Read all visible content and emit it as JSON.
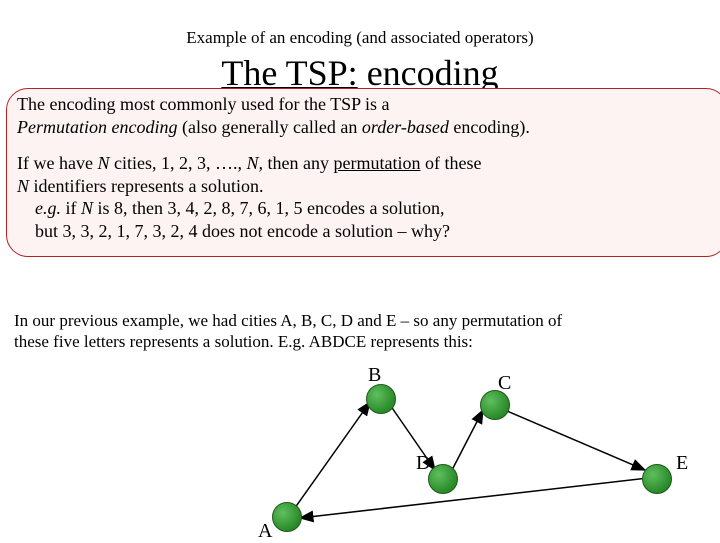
{
  "subtitle": "Example of an encoding (and associated  operators)",
  "title_prefix": "The TSP:",
  "title_suffix": " encoding",
  "box": {
    "line1a": "The encoding most commonly used for the TSP is a",
    "line2_ital1": "Permutation encoding",
    "line2_mid": " (also generally called an ",
    "line2_ital2": "order-based",
    "line2_end": " encoding).",
    "p2_l1a": "If we have ",
    "p2_l1_ital": "N",
    "p2_l1b": " cities, 1, 2, 3, …., ",
    "p2_l1_ital2": "N,",
    "p2_l1c": "  then any ",
    "p2_l1_perm": "permutation",
    "p2_l1d": " of these",
    "p2_l2_ital": "N",
    "p2_l2a": " identifiers represents a solution.",
    "p2_l3_eg": "e.g.",
    "p2_l3_mid": " if ",
    "p2_l3_ital": "N",
    "p2_l3b": " is  8,   then    3, 4, 2, 8, 7, 6, 1, 5   encodes a solution,",
    "p2_l4": "but  3, 3, 2, 1, 7, 3, 2, 4  does not encode a solution – why?"
  },
  "bottom": {
    "l1": "In our previous example, we had cities A, B, C, D and E – so any  permutation of",
    "l2": "these five letters represents a solution. E.g. ABDCE represents this:"
  },
  "nodes": {
    "A": "A",
    "B": "B",
    "C": "C",
    "D": "D",
    "E": "E"
  }
}
